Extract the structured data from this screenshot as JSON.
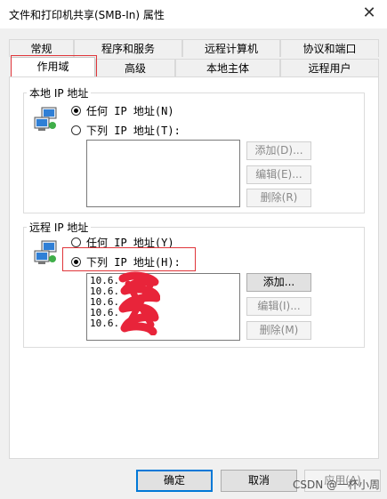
{
  "window": {
    "title": "文件和打印机共享(SMB-In) 属性",
    "close": "✕"
  },
  "tabs_row1": [
    "常规",
    "程序和服务",
    "远程计算机",
    "协议和端口"
  ],
  "tabs_row2": [
    "作用域",
    "高级",
    "本地主体",
    "远程用户"
  ],
  "active_tab": "作用域",
  "local_ip": {
    "title": "本地 IP 地址",
    "option_any": "任何 IP 地址(N)",
    "option_list": "下列 IP 地址(T):",
    "selected": "any",
    "addresses": [],
    "btn_add": "添加(D)...",
    "btn_edit": "编辑(E)...",
    "btn_remove": "删除(R)"
  },
  "remote_ip": {
    "title": "远程 IP 地址",
    "option_any": "任何 IP 地址(Y)",
    "option_list": "下列 IP 地址(H):",
    "selected": "list",
    "addresses": [
      "10.6.",
      "10.6.",
      "10.6.",
      "10.6.",
      "10.6."
    ],
    "btn_add": "添加...",
    "btn_edit": "编辑(I)...",
    "btn_remove": "删除(M)"
  },
  "footer": {
    "ok": "确定",
    "cancel": "取消",
    "apply": "应用(A)"
  },
  "watermark": "CSDN @一杯小周",
  "colors": {
    "highlight": "#e0353a",
    "accent": "#0078d7"
  }
}
